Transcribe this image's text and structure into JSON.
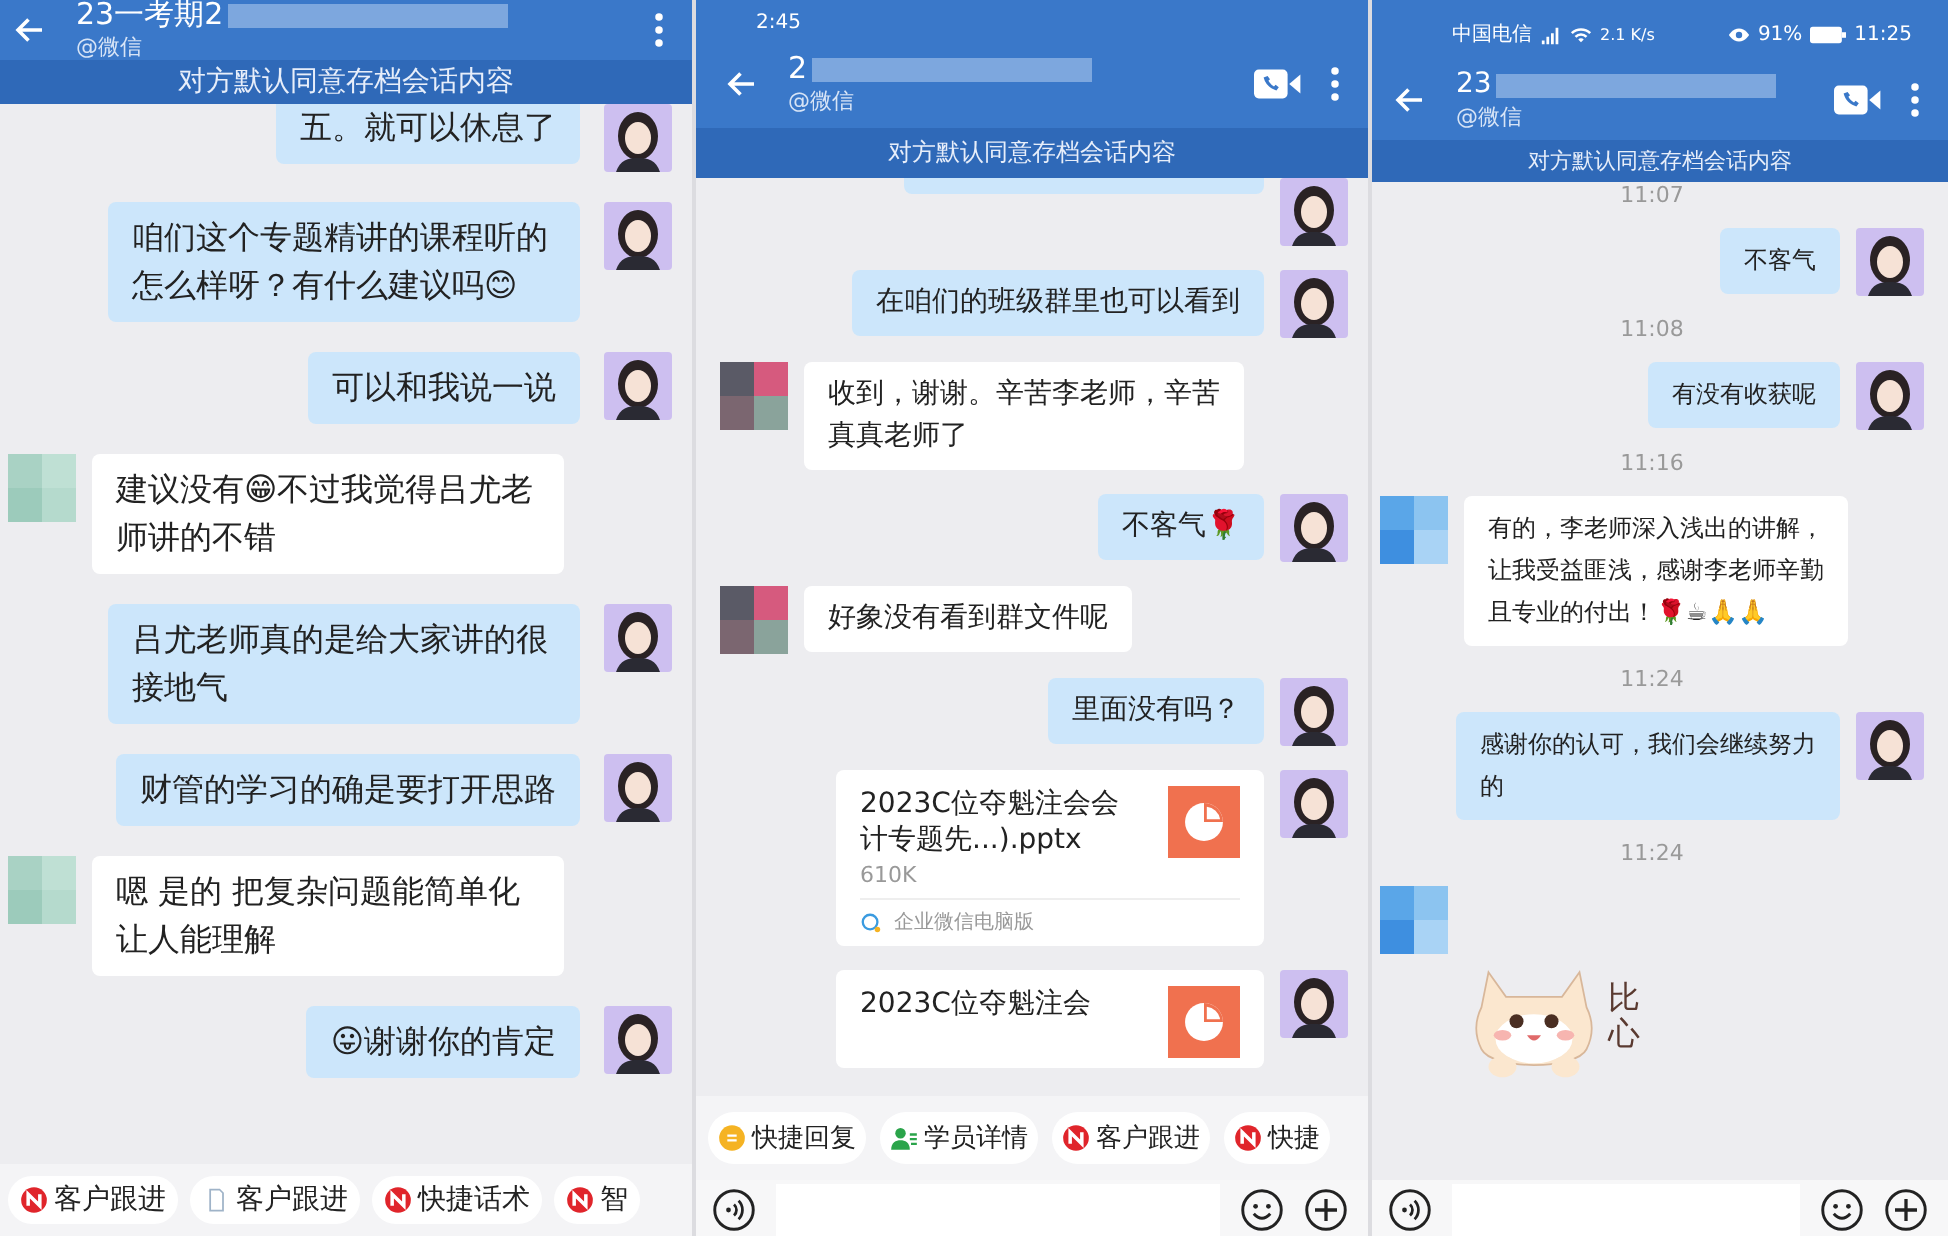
{
  "panels": [
    {
      "header": {
        "title": "23一考期2",
        "subtitle": "@微信"
      },
      "notice": "对方默认同意存档会话内容",
      "messages": [
        {
          "kind": "sent_text",
          "text": "五。就可以休息了",
          "cut_top": true
        },
        {
          "kind": "sent_text",
          "text": "咱们这个专题精讲的课程听的怎么样呀？有什么建议吗😊"
        },
        {
          "kind": "sent_text",
          "text": "可以和我说一说"
        },
        {
          "kind": "received_text",
          "text": "建议没有😁不过我觉得吕尤老师讲的不错"
        },
        {
          "kind": "sent_text",
          "text": "吕尤老师真的是给大家讲的很接地气"
        },
        {
          "kind": "sent_text",
          "text": "财管的学习的确是要打开思路"
        },
        {
          "kind": "received_text",
          "text": "嗯  是的  把复杂问题能简单化让人能理解"
        },
        {
          "kind": "sent_text",
          "text": "😛谢谢你的肯定"
        }
      ],
      "quick_actions": [
        {
          "label": "客户跟进",
          "kind": "follow"
        },
        {
          "label": "客户跟进",
          "kind": "doc"
        },
        {
          "label": "快捷话术",
          "kind": "follow"
        },
        {
          "label": "智",
          "kind": "follow"
        }
      ]
    },
    {
      "status_bar": {
        "time": "2:45"
      },
      "header": {
        "title": "2",
        "subtitle": "@微信",
        "video_call": true
      },
      "notice": "对方默认同意存档会话内容",
      "messages": [
        {
          "kind": "sent_fragment"
        },
        {
          "kind": "sent_text",
          "text": "在咱们的班级群里也可以看到"
        },
        {
          "kind": "received_text",
          "text": "收到，谢谢。辛苦李老师，辛苦真真老师了"
        },
        {
          "kind": "sent_text",
          "text": "不客气🌹"
        },
        {
          "kind": "received_text",
          "text": "好象没有看到群文件呢"
        },
        {
          "kind": "sent_text",
          "text": "里面没有吗？"
        },
        {
          "kind": "sent_file",
          "title": "2023C位夺魁注会会计专题先...).pptx",
          "size": "610K",
          "source": "企业微信电脑版"
        },
        {
          "kind": "sent_file",
          "title": "2023C位夺魁注会"
        }
      ],
      "quick_actions": [
        {
          "label": "快捷回复",
          "kind": "reply"
        },
        {
          "label": "学员详情",
          "kind": "student"
        },
        {
          "label": "客户跟进",
          "kind": "follow"
        },
        {
          "label": "快捷",
          "kind": "follow"
        }
      ],
      "input_bar": true
    },
    {
      "status_bar": {
        "carrier": "中国电信",
        "speed": "2.1 K/s",
        "battery": "91%",
        "time": "11:25"
      },
      "header": {
        "title": "23",
        "subtitle": "@微信",
        "video_call": true
      },
      "notice": "对方默认同意存档会话内容",
      "messages": [
        {
          "kind": "time",
          "text": "11:07"
        },
        {
          "kind": "sent_text",
          "text": "不客气"
        },
        {
          "kind": "time",
          "text": "11:08"
        },
        {
          "kind": "sent_text",
          "text": "有没有收获呢"
        },
        {
          "kind": "time",
          "text": "11:16"
        },
        {
          "kind": "received_text",
          "text": "有的，李老师深入浅出的讲解，让我受益匪浅，感谢李老师辛勤且专业的付出！🌹☕🙏🙏"
        },
        {
          "kind": "time",
          "text": "11:24"
        },
        {
          "kind": "sent_text",
          "text": "感谢你的认可，我们会继续努力的"
        },
        {
          "kind": "time",
          "text": "11:24"
        },
        {
          "kind": "received_sticker",
          "text": "比心"
        }
      ],
      "input_bar": true
    }
  ]
}
